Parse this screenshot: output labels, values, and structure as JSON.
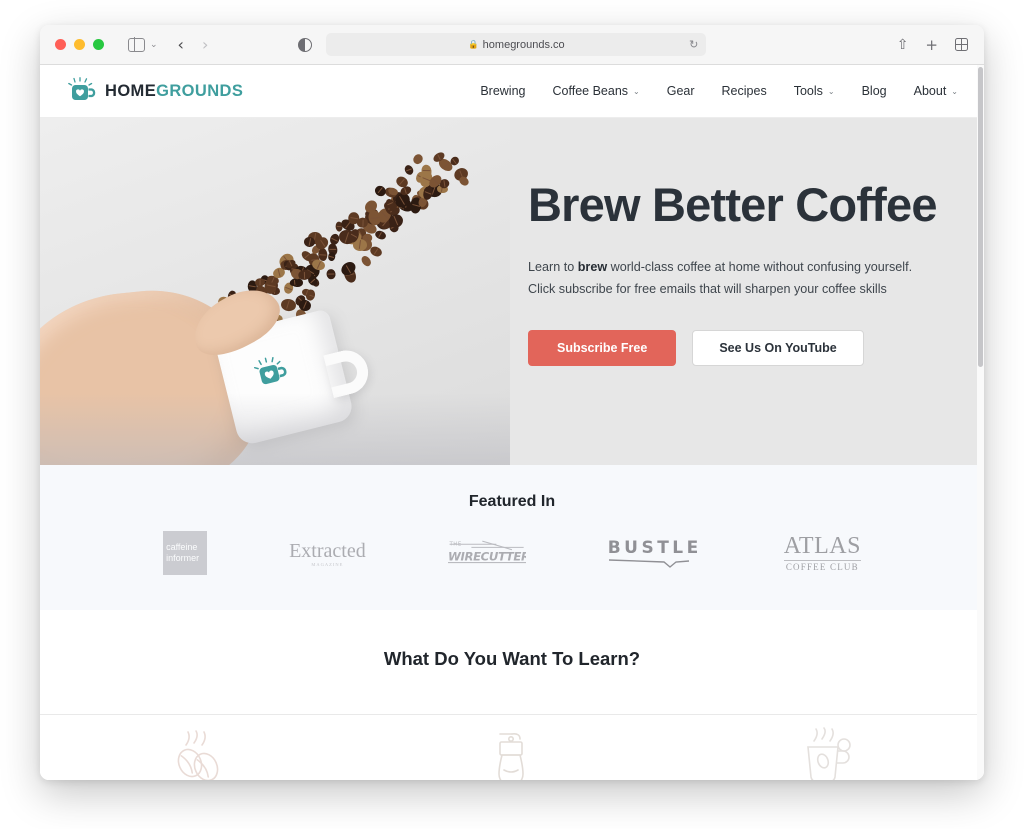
{
  "browser": {
    "url": "homegrounds.co",
    "lock_icon": "lock-icon",
    "reload_icon": "↻",
    "reader_icon": "reader-view-icon",
    "sidebar_icon": "sidebar-toggle-icon",
    "back_arrow": "‹",
    "forward_arrow": "›",
    "share_icon": "⇪",
    "new_tab_icon": "+",
    "tab_overview_icon": "tab-overview-icon",
    "chevron": "⌄"
  },
  "site": {
    "logo": {
      "part1": "HOME",
      "part2": "GROUNDS",
      "mark": "coffee-mug-logo-icon"
    },
    "nav": [
      {
        "label": "Brewing",
        "caret": false
      },
      {
        "label": "Coffee Beans",
        "caret": true
      },
      {
        "label": "Gear",
        "caret": false
      },
      {
        "label": "Recipes",
        "caret": false
      },
      {
        "label": "Tools",
        "caret": true
      },
      {
        "label": "Blog",
        "caret": false
      },
      {
        "label": "About",
        "caret": true
      }
    ],
    "caret_glyph": "⌄"
  },
  "hero": {
    "title": "Brew Better Coffee",
    "sub_line1_pre": "Learn to ",
    "sub_line1_bold": "brew",
    "sub_line1_post": " world-class coffee at home without confusing yourself.",
    "sub_line2": "Click subscribe for free emails that will sharpen your coffee skills",
    "primary_button": "Subscribe Free",
    "secondary_button": "See Us On YouTube",
    "image_alt": "hand-holding-mug-with-coffee-beans-photo",
    "primary_color": "#e2655a",
    "background_color": "#e7e7e7"
  },
  "featured": {
    "title": "Featured In",
    "background_color": "#f7f9fc",
    "logos": [
      {
        "name": "caffeine-informer-logo",
        "line1": "caffeine",
        "line2": "informer"
      },
      {
        "name": "extracted-logo",
        "main": "Extracted",
        "sub": "MAGAZINE"
      },
      {
        "name": "the-wirecutter-logo",
        "main": "THE WIRECUTTER"
      },
      {
        "name": "bustle-logo",
        "main": "BUSTLE"
      },
      {
        "name": "atlas-coffee-club-logo",
        "main": "ATLAS",
        "sub": "COFFEE CLUB"
      }
    ]
  },
  "learn": {
    "title": "What Do You Want To Learn?",
    "cards": [
      {
        "icon": "coffee-beans-icon"
      },
      {
        "icon": "coffee-grinder-icon"
      },
      {
        "icon": "coffee-cup-icon"
      }
    ]
  }
}
